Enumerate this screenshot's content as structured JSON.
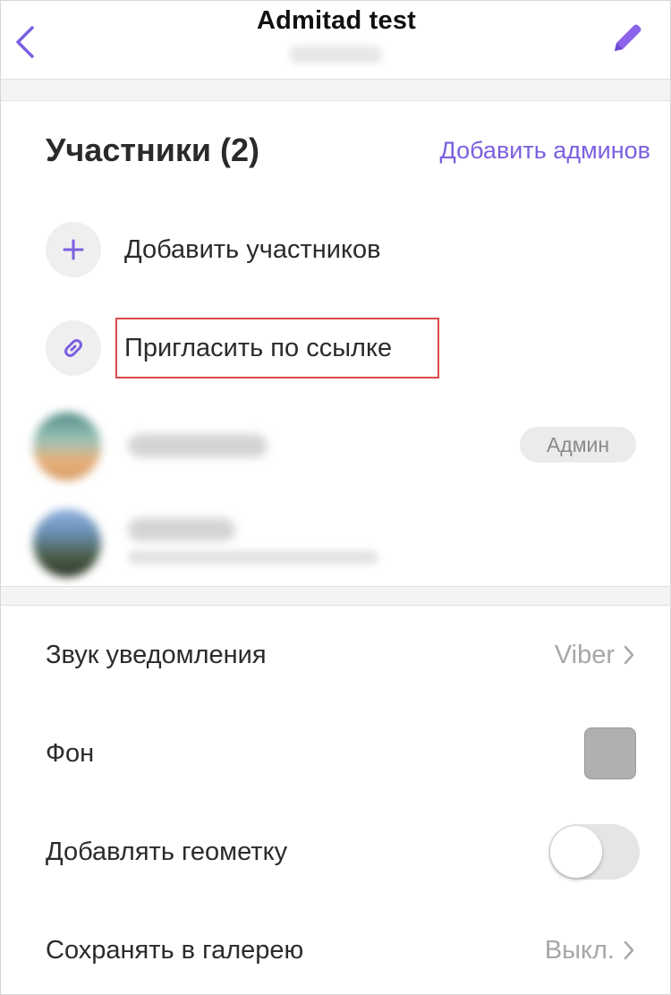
{
  "header": {
    "title": "Admitad test",
    "back_icon": "chevron-left-icon",
    "edit_icon": "pencil-icon",
    "accent_color": "#7b5fe0"
  },
  "members": {
    "title": "Участники (2)",
    "add_admins_label": "Добавить админов",
    "add_members_label": "Добавить участников",
    "add_members_icon": "plus-icon",
    "invite_link_label": "Пригласить по ссылке",
    "invite_link_icon": "link-icon",
    "list": [
      {
        "admin_badge": "Админ"
      },
      {}
    ]
  },
  "settings": {
    "notification_sound": {
      "label": "Звук уведомления",
      "value": "Viber"
    },
    "background": {
      "label": "Фон",
      "swatch_color": "#b0b0b0"
    },
    "geotag": {
      "label": "Добавлять геометку",
      "enabled": false
    },
    "save_to_gallery": {
      "label": "Сохранять в галерею",
      "value": "Выкл."
    }
  }
}
